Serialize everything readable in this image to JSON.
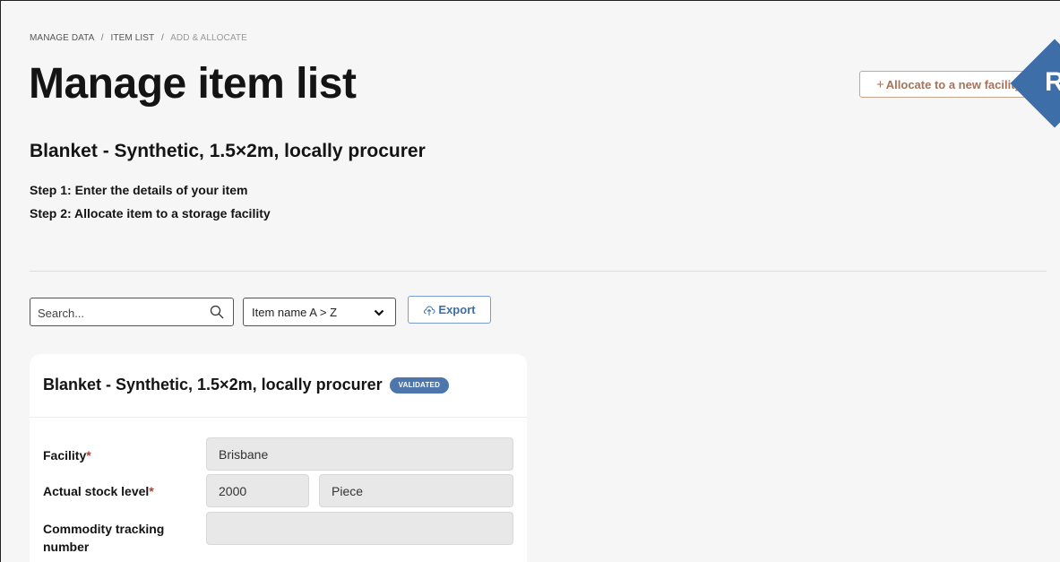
{
  "breadcrumb": {
    "items": [
      "MANAGE DATA",
      "ITEM LIST",
      "ADD & ALLOCATE"
    ],
    "separator": "/"
  },
  "page": {
    "title": "Manage item list",
    "allocate_button": "Allocate to a new facility",
    "allocate_plus": "+",
    "help_letter": "R"
  },
  "item": {
    "heading": "Blanket - Synthetic, 1.5×2m, locally procurer",
    "step1": "Step 1: Enter the details of your item",
    "step2": "Step 2: Allocate item to a storage facility"
  },
  "toolbar": {
    "search_placeholder": "Search...",
    "sort_value": "Item name A > Z",
    "export_label": "Export"
  },
  "card": {
    "title": "Blanket - Synthetic, 1.5×2m, locally procurer",
    "badge": "VALIDATED",
    "fields": {
      "facility_label": "Facility",
      "facility_value": "Brisbane",
      "stock_label": "Actual stock level",
      "stock_value": "2000",
      "unit_value": "Piece",
      "tracking_label_line1": "Commodity tracking",
      "tracking_label_line2": "number",
      "tracking_value": ""
    },
    "required_mark": "*"
  },
  "colors": {
    "accent_blue": "#3d6ea8",
    "accent_brown": "#a5735a",
    "badge_blue": "#4d76ad",
    "required_red": "#c0392b"
  },
  "icons": {
    "search": "search-icon",
    "sort": "chevron-down-icon",
    "export": "cloud-upload-icon"
  }
}
